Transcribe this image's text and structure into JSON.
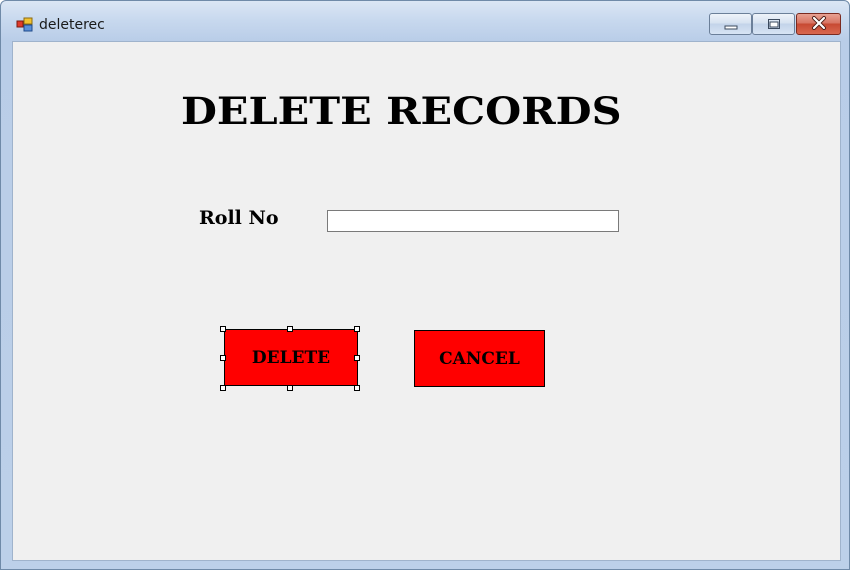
{
  "window": {
    "title": "deleterec",
    "app_icon": "form-icon",
    "controls": {
      "minimize_icon": "minimize-icon",
      "maximize_icon": "maximize-icon",
      "close_icon": "close-icon"
    }
  },
  "form": {
    "heading": "DELETE RECORDS",
    "roll_no_label": "Roll No",
    "roll_no_value": "",
    "delete_button": "DELETE",
    "cancel_button": "CANCEL"
  },
  "colors": {
    "button_red": "#ff0000",
    "form_background": "#f0f0f0"
  }
}
